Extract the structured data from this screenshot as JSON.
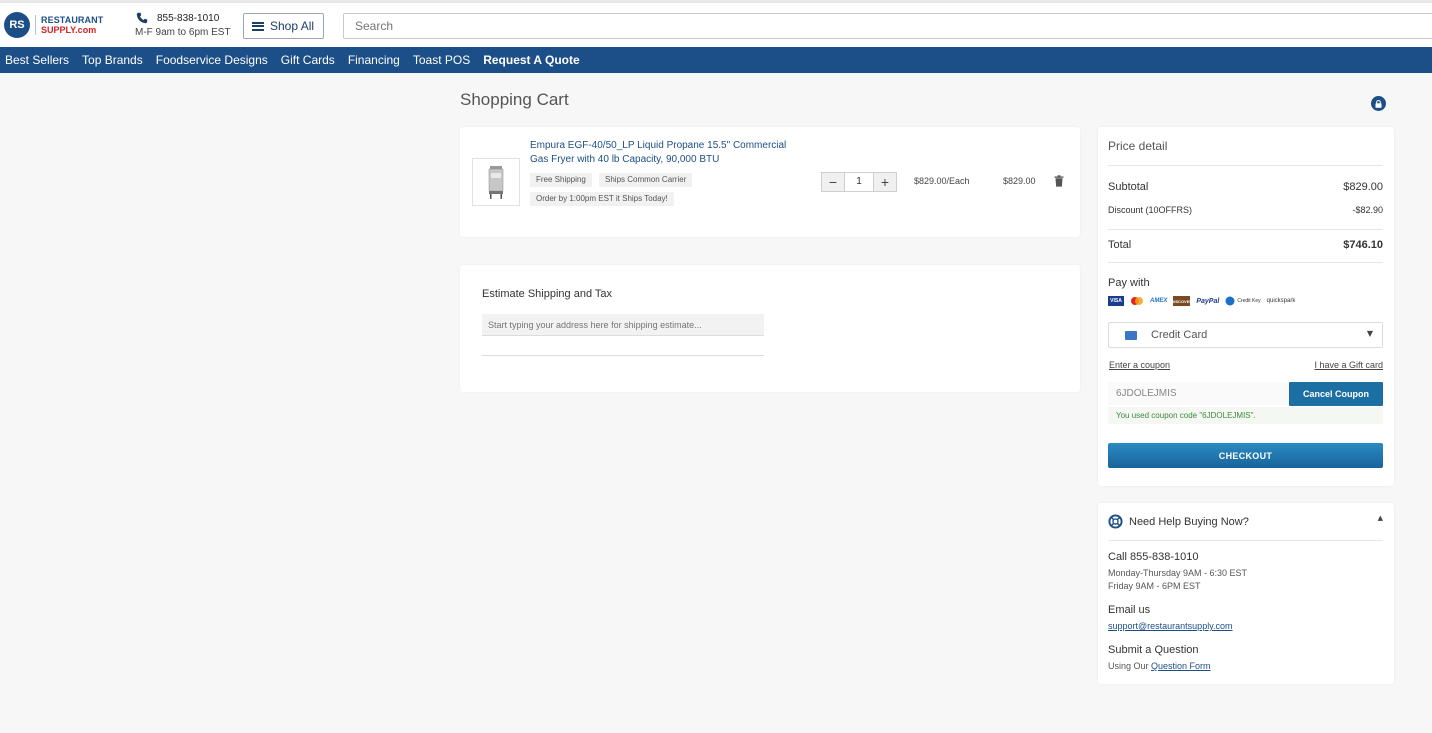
{
  "header": {
    "logo_top": "RESTAURANT",
    "logo_bottom": "SUPPLY.com",
    "phone": "855-838-1010",
    "hours": "M-F 9am to 6pm EST",
    "shop_all_label": "Shop All",
    "search_placeholder": "Search"
  },
  "nav": {
    "items": [
      "Best Sellers",
      "Top Brands",
      "Foodservice Designs",
      "Gift Cards",
      "Financing",
      "Toast POS",
      "Request A Quote"
    ]
  },
  "cart": {
    "title": "Shopping Cart",
    "item": {
      "name": "Empura EGF-40/50_LP Liquid Propane 15.5\" Commercial Gas Fryer with 40 lb Capacity, 90,000 BTU",
      "tags": [
        "Free Shipping",
        "Ships Common Carrier"
      ],
      "note": "Order by 1:00pm EST it Ships Today!",
      "quantity": "1",
      "unit_price": "$829.00/Each",
      "line_total": "$829.00"
    }
  },
  "shipping": {
    "title": "Estimate Shipping and Tax",
    "address_placeholder": "Start typing your address here for shipping estimate..."
  },
  "price_detail": {
    "title": "Price detail",
    "subtotal_label": "Subtotal",
    "subtotal_value": "$829.00",
    "discount_label": "Discount (10OFFRS)",
    "discount_value": "-$82.90",
    "total_label": "Total",
    "total_value": "$746.10",
    "pay_with_label": "Pay with",
    "pay_logos": [
      "VISA",
      "AMEX",
      "DISCOVER",
      "PayPal",
      "Credit Key",
      "quickspark"
    ],
    "payment_method": "Credit Card",
    "enter_coupon": "Enter a coupon",
    "gift_card": "I have a Gift card",
    "coupon_code": "6JDOLEJMIS",
    "cancel_coupon": "Cancel Coupon",
    "coupon_message": "You used coupon code \"6JDOLEJMIS\".",
    "checkout_label": "CHECKOUT"
  },
  "help": {
    "title": "Need Help Buying Now?",
    "call": "Call 855-838-1010",
    "hours_1": "Monday-Thursday 9AM - 6:30 EST",
    "hours_2": "Friday 9AM - 6PM EST",
    "email_label": "Email us",
    "email": "support@restaurantsupply.com",
    "question_label": "Submit a Question",
    "using_our": "Using Our",
    "question_form": "Question Form"
  },
  "colors": {
    "brand_blue": "#1c4f87",
    "accent_red": "#d2232a",
    "button_blue": "#1c6fa3"
  }
}
